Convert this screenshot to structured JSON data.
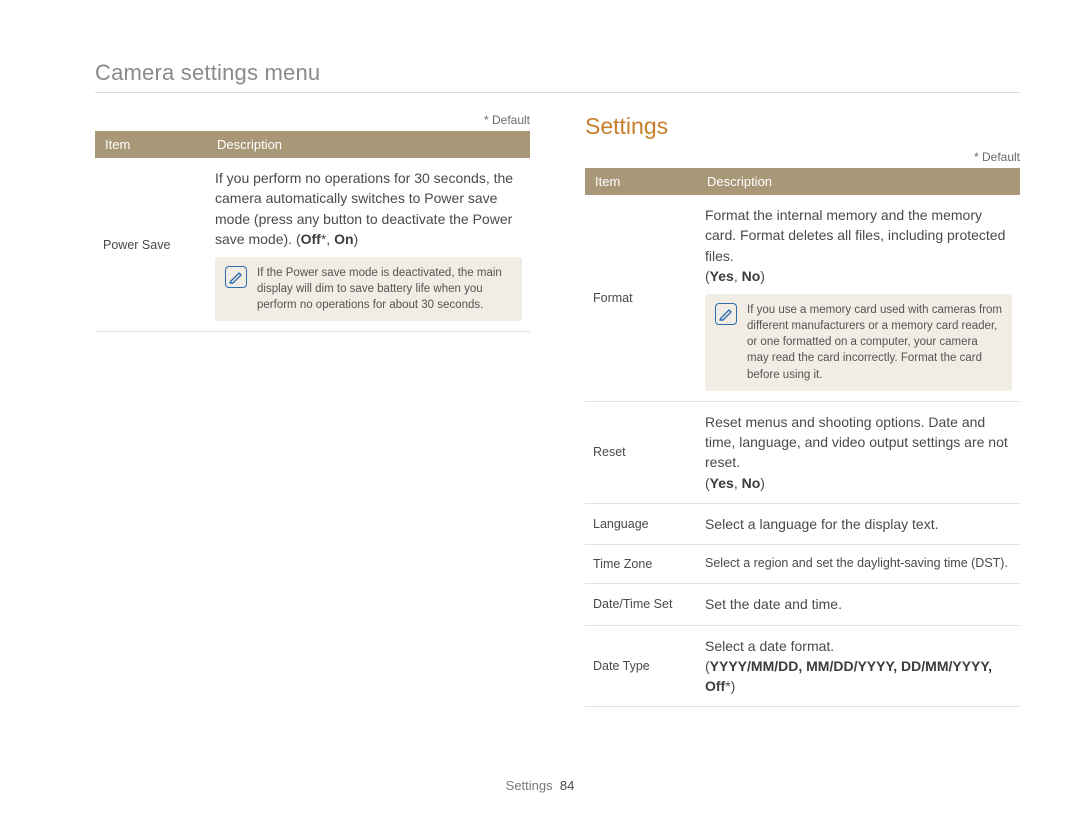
{
  "page_title": "Camera settings menu",
  "default_note": "* Default",
  "section_heading": "Settings",
  "table_headers": {
    "item": "Item",
    "description": "Description"
  },
  "left": {
    "power_save": {
      "item": "Power Save",
      "desc": "If you perform no operations for 30 seconds, the camera automatically switches to Power save mode (press any button to deactivate the Power save mode). ",
      "opts_open": "(",
      "opt1": "Off",
      "opt_star": "*",
      "opt_sep": ", ",
      "opt2": "On",
      "opts_close": ")",
      "note": "If the Power save mode is deactivated, the main display will dim to save battery life when you perform no operations for about 30 seconds."
    }
  },
  "right": {
    "format": {
      "item": "Format",
      "desc": "Format the internal memory and the memory card. Format deletes all files, including protected files.",
      "opts_open": "(",
      "opt1": "Yes",
      "opt_sep": ", ",
      "opt2": "No",
      "opts_close": ")",
      "note": "If you use a memory card used with cameras from different manufacturers or a memory card reader, or one formatted on a computer, your camera may read the card incorrectly. Format the card before using it."
    },
    "reset": {
      "item": "Reset",
      "desc": "Reset menus and shooting options. Date and time, language, and video output settings are not reset.",
      "opts_open": "(",
      "opt1": "Yes",
      "opt_sep": ", ",
      "opt2": "No",
      "opts_close": ")"
    },
    "language": {
      "item": "Language",
      "desc": "Select a language for the display text."
    },
    "time_zone": {
      "item": "Time Zone",
      "desc": "Select a region and set the daylight-saving time (DST)."
    },
    "date_time_set": {
      "item": "Date/Time Set",
      "desc": "Set the date and time."
    },
    "date_type": {
      "item": "Date Type",
      "desc": "Select a date format.",
      "opts_open": "(",
      "opt1": "YYYY/MM/DD",
      "sep1": ", ",
      "opt2": "MM/DD/YYYY",
      "sep2": ", ",
      "opt3": "DD/MM/YYYY",
      "sep3": ", ",
      "opt4": "Off",
      "opt_star": "*",
      "opts_close": ")"
    }
  },
  "footer": {
    "label": "Settings",
    "page": "84"
  },
  "icons": {
    "note": "note-icon"
  }
}
